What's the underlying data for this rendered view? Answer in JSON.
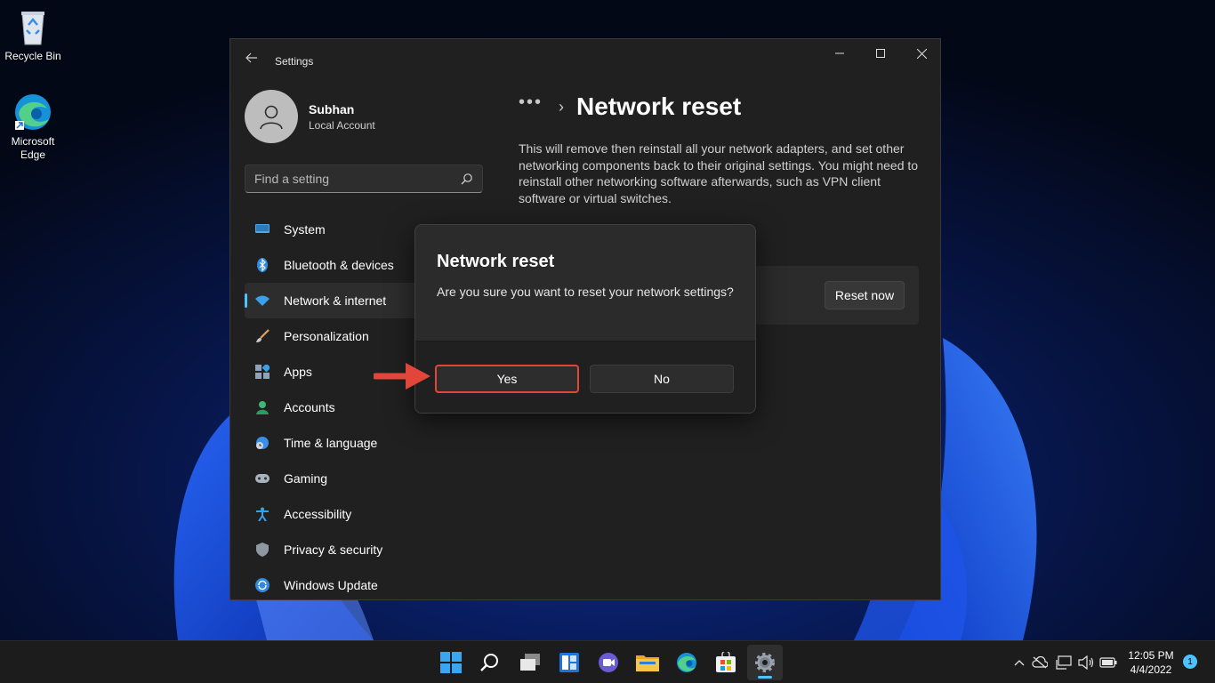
{
  "desktop": {
    "icons": [
      {
        "label": "Recycle Bin"
      },
      {
        "label": "Microsoft Edge"
      }
    ]
  },
  "window": {
    "app_title": "Settings",
    "profile": {
      "name": "Subhan",
      "account_type": "Local Account"
    },
    "search": {
      "placeholder": "Find a setting"
    },
    "nav_items": [
      {
        "label": "System",
        "icon": "monitor-icon"
      },
      {
        "label": "Bluetooth & devices",
        "icon": "bluetooth-icon"
      },
      {
        "label": "Network & internet",
        "icon": "wifi-icon",
        "selected": true
      },
      {
        "label": "Personalization",
        "icon": "brush-icon"
      },
      {
        "label": "Apps",
        "icon": "apps-icon"
      },
      {
        "label": "Accounts",
        "icon": "person-icon"
      },
      {
        "label": "Time & language",
        "icon": "globe-clock-icon"
      },
      {
        "label": "Gaming",
        "icon": "gamepad-icon"
      },
      {
        "label": "Accessibility",
        "icon": "accessibility-icon"
      },
      {
        "label": "Privacy & security",
        "icon": "shield-icon"
      },
      {
        "label": "Windows Update",
        "icon": "update-icon"
      }
    ],
    "breadcrumb": {
      "more": "•••",
      "separator": "›"
    },
    "page_title": "Network reset",
    "description": "This will remove then reinstall all your network adapters, and set other networking components back to their original settings. You might need to reinstall other networking software afterwards, such as VPN client software or virtual switches.",
    "reset_button": "Reset now"
  },
  "dialog": {
    "title": "Network reset",
    "message": "Are you sure you want to reset your network settings?",
    "yes_label": "Yes",
    "no_label": "No"
  },
  "taskbar": {
    "apps": [
      "start-icon",
      "search-icon",
      "task-view-icon",
      "widgets-icon",
      "chat-icon",
      "file-explorer-icon",
      "edge-icon",
      "store-icon",
      "settings-icon"
    ],
    "active_app": "settings-icon",
    "clock": {
      "time": "12:05 PM",
      "date": "4/4/2022"
    },
    "notification_count": "1"
  },
  "colors": {
    "accent": "#4cc2ff",
    "highlight": "#e2453a",
    "window_bg": "#202020",
    "dialog_bg": "#2b2b2b"
  }
}
